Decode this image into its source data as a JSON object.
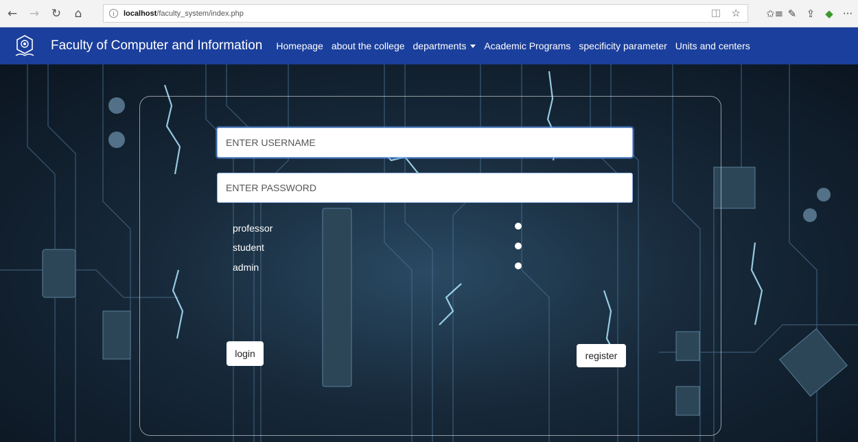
{
  "browser": {
    "back_icon": "←",
    "forward_icon": "→",
    "refresh_icon": "↻",
    "home_icon": "⌂",
    "info_icon": "i",
    "url_host": "localhost",
    "url_path": "/faculty_system/index.php",
    "favorite_icon": "☆",
    "favorites_list_icon": "✩≡",
    "notes_icon": "✎",
    "share_icon": "⇪",
    "extension_icon": "◆",
    "more_icon": "···"
  },
  "navbar": {
    "brand": "Faculty of Computer and Information",
    "items": [
      {
        "label": "Homepage"
      },
      {
        "label": "about the college"
      },
      {
        "label": "departments"
      },
      {
        "label": "Academic Programs"
      },
      {
        "label": "specificity parameter"
      },
      {
        "label": "Units and centers"
      }
    ],
    "color": "#1b3f9c"
  },
  "form": {
    "username_placeholder": "ENTER USERNAME",
    "password_placeholder": "ENTER PASSWORD",
    "roles": [
      {
        "label": "professor"
      },
      {
        "label": "student"
      },
      {
        "label": "admin"
      }
    ],
    "login_label": "login",
    "register_label": "register"
  }
}
